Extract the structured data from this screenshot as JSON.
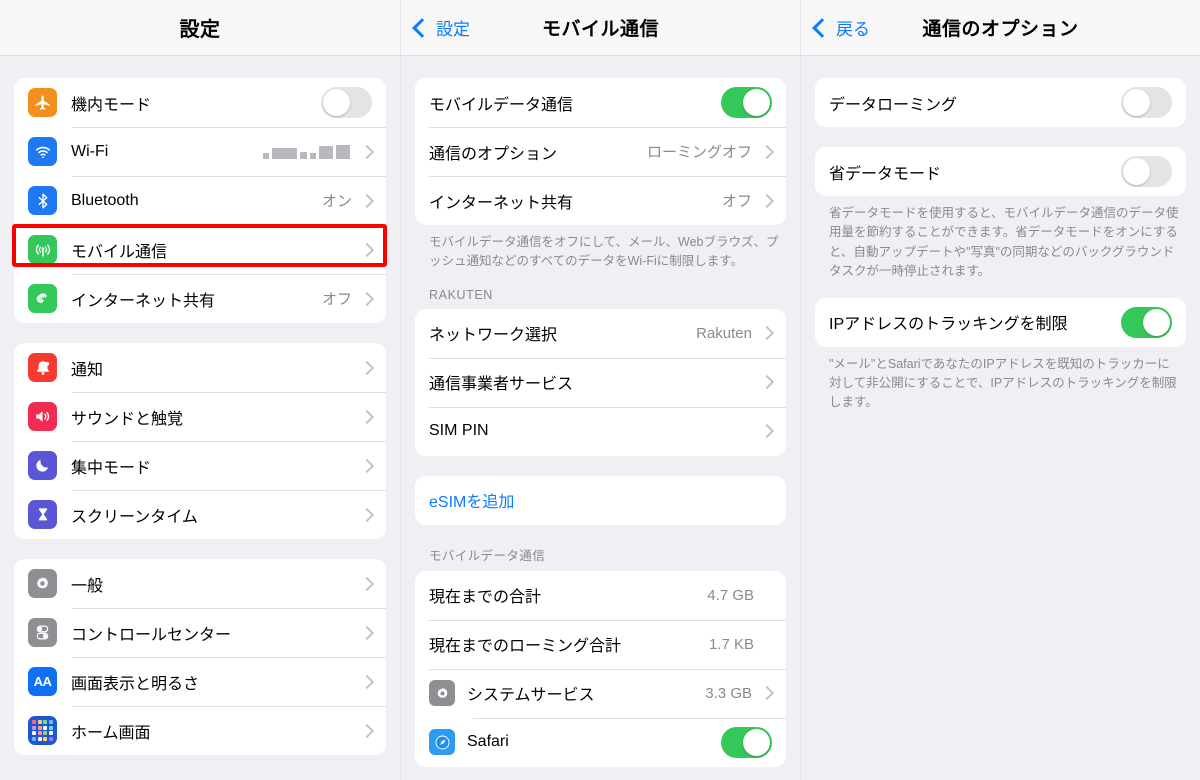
{
  "panel1": {
    "nav": {
      "title": "設定"
    },
    "group1": [
      {
        "icon": "airplane-icon",
        "label": "機内モード",
        "accessory": "toggle",
        "toggle_on": false
      },
      {
        "icon": "wifi-icon",
        "label": "Wi-Fi",
        "accessory": "redacted-chevron"
      },
      {
        "icon": "bluetooth-icon",
        "label": "Bluetooth",
        "value": "オン",
        "accessory": "chevron"
      },
      {
        "icon": "cellular-icon",
        "label": "モバイル通信",
        "accessory": "chevron",
        "highlighted": true
      },
      {
        "icon": "personal-hotspot-icon",
        "label": "インターネット共有",
        "value": "オフ",
        "accessory": "chevron"
      }
    ],
    "group2": [
      {
        "icon": "notifications-icon",
        "label": "通知",
        "accessory": "chevron"
      },
      {
        "icon": "sounds-haptics-icon",
        "label": "サウンドと触覚",
        "accessory": "chevron"
      },
      {
        "icon": "focus-icon",
        "label": "集中モード",
        "accessory": "chevron"
      },
      {
        "icon": "screen-time-icon",
        "label": "スクリーンタイム",
        "accessory": "chevron"
      }
    ],
    "group3": [
      {
        "icon": "general-gear-icon",
        "label": "一般",
        "accessory": "chevron"
      },
      {
        "icon": "control-center-icon",
        "label": "コントロールセンター",
        "accessory": "chevron"
      },
      {
        "icon": "display-brightness-icon",
        "label": "画面表示と明るさ",
        "accessory": "chevron"
      },
      {
        "icon": "home-screen-icon",
        "label": "ホーム画面",
        "accessory": "chevron"
      }
    ]
  },
  "panel2": {
    "nav": {
      "back_label": "設定",
      "title": "モバイル通信"
    },
    "group1": [
      {
        "label": "モバイルデータ通信",
        "accessory": "toggle",
        "toggle_on": true
      },
      {
        "label": "通信のオプション",
        "value": "ローミングオフ",
        "accessory": "chevron",
        "highlighted": true
      },
      {
        "label": "インターネット共有",
        "value": "オフ",
        "accessory": "chevron"
      }
    ],
    "footer1": "モバイルデータ通信をオフにして、メール、Webブラウズ、プッシュ通知などのすべてのデータをWi-Fiに制限します。",
    "section2_header": "RAKUTEN",
    "group2": [
      {
        "label": "ネットワーク選択",
        "value": "Rakuten",
        "accessory": "chevron"
      },
      {
        "label": "通信事業者サービス",
        "accessory": "chevron"
      },
      {
        "label": "SIM PIN",
        "accessory": "chevron"
      }
    ],
    "group3": [
      {
        "label": "eSIMを追加",
        "style": "blue"
      }
    ],
    "section4_header": "モバイルデータ通信",
    "group4": [
      {
        "label": "現在までの合計",
        "value": "4.7 GB"
      },
      {
        "label": "現在までのローミング合計",
        "value": "1.7 KB"
      },
      {
        "icon": "general-gear-icon",
        "label": "システムサービス",
        "value": "3.3 GB",
        "accessory": "chevron"
      },
      {
        "icon": "safari-icon",
        "label": "Safari",
        "accessory": "toggle",
        "toggle_on": true
      }
    ]
  },
  "panel3": {
    "nav": {
      "back_label": "戻る",
      "title": "通信のオプション"
    },
    "group1": [
      {
        "label": "データローミング",
        "accessory": "toggle",
        "toggle_on": false
      }
    ],
    "group2": [
      {
        "label": "省データモード",
        "accessory": "toggle",
        "toggle_on": false,
        "highlighted": true
      }
    ],
    "footer2": "省データモードを使用すると、モバイルデータ通信のデータ使用量を節約することができます。省データモードをオンにすると、自動アップデートや\"写真\"の同期などのバックグラウンドタスクが一時停止されます。",
    "group3": [
      {
        "label": "IPアドレスのトラッキングを制限",
        "accessory": "toggle",
        "toggle_on": true
      }
    ],
    "footer3": "\"メール\"とSafariであなたのIPアドレスを既知のトラッカーに対して非公開にすることで、IPアドレスのトラッキングを制限します。"
  },
  "colors": {
    "accent_blue": "#0a7cff",
    "toggle_on_green": "#34C759",
    "toggle_off_gray": "#E4E4E6",
    "highlight_red": "#FF0000",
    "page_background": "#EFEFF4",
    "card_background": "#FFFFFF",
    "secondary_text": "#8A8A8E"
  }
}
